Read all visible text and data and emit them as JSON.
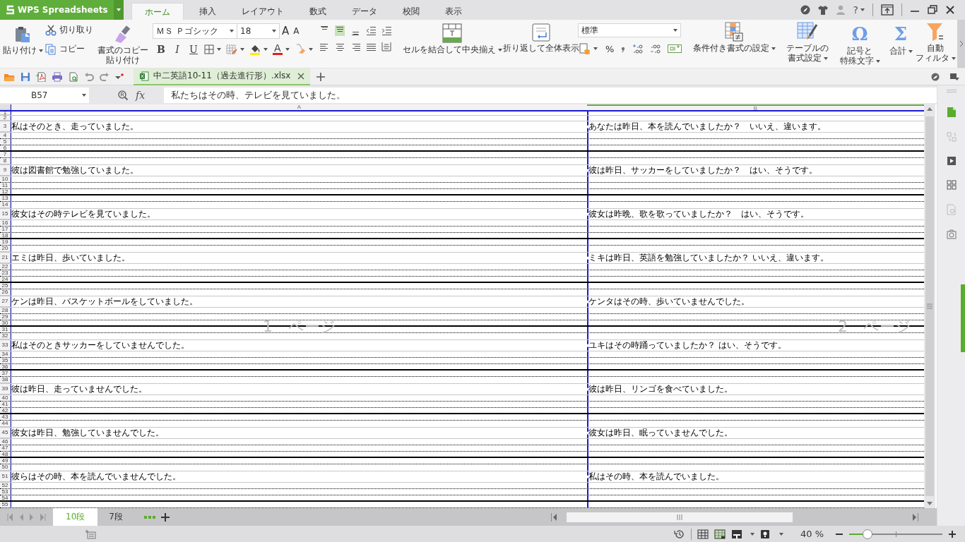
{
  "app": {
    "name": "WPS Spreadsheets"
  },
  "menu_tabs": [
    {
      "label": "ホーム",
      "selected": true
    },
    {
      "label": "挿入",
      "selected": false
    },
    {
      "label": "レイアウト",
      "selected": false
    },
    {
      "label": "数式",
      "selected": false
    },
    {
      "label": "データ",
      "selected": false
    },
    {
      "label": "校閲",
      "selected": false
    },
    {
      "label": "表示",
      "selected": false
    }
  ],
  "help": "?",
  "ribbon": {
    "paste": "貼り付け",
    "cut": "切り取り",
    "copy": "コピー",
    "format_painter": [
      "書式のコピー",
      "貼り付け"
    ],
    "font_name": "ＭＳ Ｐゴシック",
    "font_size": "18",
    "grow": "A",
    "shrink": "A",
    "styles": [
      {
        "kind": "bold",
        "label": "B"
      },
      {
        "kind": "italic",
        "label": "I"
      },
      {
        "kind": "underline",
        "label": "U"
      }
    ],
    "font_color": "A",
    "align_top": [
      {
        "kind": "top",
        "selected": false
      },
      {
        "kind": "middle",
        "selected": true
      },
      {
        "kind": "bottom",
        "selected": false
      },
      {
        "kind": "outdent",
        "selected": false
      },
      {
        "kind": "indent",
        "selected": false
      }
    ],
    "align_bottom": [
      {
        "kind": "left",
        "selected": false
      },
      {
        "kind": "center",
        "selected": false
      },
      {
        "kind": "right",
        "selected": false
      },
      {
        "kind": "justify",
        "selected": false
      },
      {
        "kind": "distribute",
        "selected": false
      }
    ],
    "merge": "セルを結合して中央揃え",
    "wrap": "折り返して全体表示",
    "number_format": "標準",
    "percent": "%",
    "conditional": "条件付き書式の設定",
    "table_format": [
      "テーブルの",
      "書式設定"
    ],
    "symbol_glyph": "Ω",
    "symbol": [
      "記号と",
      "特殊文字"
    ],
    "sum_glyph": "Σ",
    "sum": "合計",
    "filter": [
      "自動",
      "フィルタ"
    ]
  },
  "document_tabs": [
    {
      "title": "中二英語10-11（過去進行形）.xlsx",
      "selected": true
    }
  ],
  "formula_bar": {
    "cell": "B57",
    "fx": "fx",
    "content": "私たちはその時、テレビを見ていました。"
  },
  "sheet": {
    "columns": [
      "A",
      "B"
    ],
    "pages": [
      "1　ページ",
      "2　ページ"
    ],
    "rows": [
      {
        "number": "1",
        "kind": "header"
      },
      {
        "number": "2",
        "kind": "header"
      },
      {
        "number": "3",
        "kind": "text",
        "a": "私はそのとき、走っていました。",
        "b": "あなたは昨日、本を読んでいましたか？　いいえ、違います。"
      },
      {
        "number": "4",
        "kind": "dotted"
      },
      {
        "number": "5",
        "kind": "dotted"
      },
      {
        "number": "6",
        "kind": "solid"
      },
      {
        "number": "7",
        "kind": "dotted"
      },
      {
        "number": "8",
        "kind": "gap"
      },
      {
        "number": "9",
        "kind": "text",
        "a": "彼は図書館で勉強していました。",
        "b": "彼は昨日、サッカーをしていましたか？　はい、そうです。"
      },
      {
        "number": "10",
        "kind": "dotted"
      },
      {
        "number": "11",
        "kind": "dotted"
      },
      {
        "number": "12",
        "kind": "solid"
      },
      {
        "number": "13",
        "kind": "dotted"
      },
      {
        "number": "14",
        "kind": "gap"
      },
      {
        "number": "15",
        "kind": "text",
        "a": "彼女はその時テレビを見ていました。",
        "b": "彼女は昨晩、歌を歌っていましたか？　はい、そうです。"
      },
      {
        "number": "16",
        "kind": "dotted"
      },
      {
        "number": "17",
        "kind": "dotted"
      },
      {
        "number": "18",
        "kind": "solid"
      },
      {
        "number": "19",
        "kind": "dotted"
      },
      {
        "number": "20",
        "kind": "gap"
      },
      {
        "number": "21",
        "kind": "text",
        "a": "エミは昨日、歩いていました。",
        "b": "ミキは昨日、英語を勉強していましたか？ いいえ、違います。"
      },
      {
        "number": "22",
        "kind": "dotted"
      },
      {
        "number": "23",
        "kind": "dotted"
      },
      {
        "number": "24",
        "kind": "solid"
      },
      {
        "number": "25",
        "kind": "dotted"
      },
      {
        "number": "26",
        "kind": "gap"
      },
      {
        "number": "27",
        "kind": "text",
        "a": "ケンは昨日、バスケットボールをしていました。",
        "b": "ケンタはその時、歩いていませんでした。"
      },
      {
        "number": "28",
        "kind": "dotted"
      },
      {
        "number": "29",
        "kind": "dotted"
      },
      {
        "number": "30",
        "kind": "solid"
      },
      {
        "number": "31",
        "kind": "dotted"
      },
      {
        "number": "32",
        "kind": "gap"
      },
      {
        "number": "33",
        "kind": "text",
        "a": "私はそのときサッカーをしていませんでした。",
        "b": "ユキはその時踊っていましたか？ はい、そうです。"
      },
      {
        "number": "34",
        "kind": "dotted"
      },
      {
        "number": "35",
        "kind": "dotted"
      },
      {
        "number": "36",
        "kind": "solid"
      },
      {
        "number": "37",
        "kind": "dotted"
      },
      {
        "number": "38",
        "kind": "gap"
      },
      {
        "number": "39",
        "kind": "text",
        "a": "彼は昨日、走っていませんでした。",
        "b": "彼は昨日、リンゴを食べていました。"
      },
      {
        "number": "40",
        "kind": "dotted"
      },
      {
        "number": "41",
        "kind": "dotted"
      },
      {
        "number": "42",
        "kind": "solid"
      },
      {
        "number": "43",
        "kind": "dotted"
      },
      {
        "number": "44",
        "kind": "gap"
      },
      {
        "number": "45",
        "kind": "text",
        "a": "彼女は昨日、勉強していませんでした。",
        "b": "彼女は昨日、眠っていませんでした。"
      },
      {
        "number": "46",
        "kind": "dotted"
      },
      {
        "number": "47",
        "kind": "dotted"
      },
      {
        "number": "48",
        "kind": "solid"
      },
      {
        "number": "49",
        "kind": "dotted"
      },
      {
        "number": "50",
        "kind": "gap"
      },
      {
        "number": "51",
        "kind": "text",
        "a": "彼らはその時、本を読んでいませんでした。",
        "b": "私はその時、本を読んでいました。"
      },
      {
        "number": "52",
        "kind": "dotted"
      },
      {
        "number": "53",
        "kind": "dotted"
      },
      {
        "number": "54",
        "kind": "solid"
      },
      {
        "number": "55",
        "kind": "dotted"
      }
    ]
  },
  "sheet_tabs": [
    {
      "label": "10段",
      "selected": true
    },
    {
      "label": "7段",
      "selected": false
    }
  ],
  "status": {
    "views": [
      {
        "kind": "normal",
        "selected": false
      },
      {
        "kind": "page_break",
        "selected": true
      },
      {
        "kind": "page_layout",
        "selected": false
      },
      {
        "kind": "reading",
        "selected": false
      }
    ],
    "zoom": "40 %",
    "zoom_slider": {
      "level": 0.2
    }
  }
}
